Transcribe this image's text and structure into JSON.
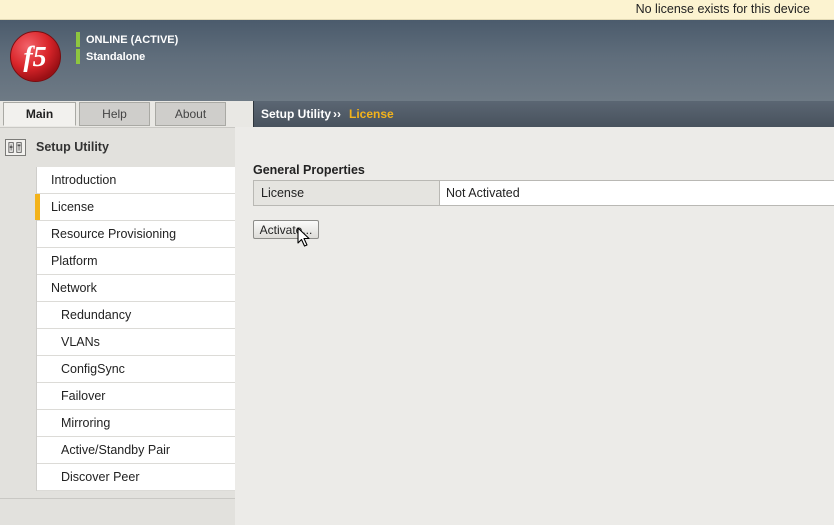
{
  "notice": {
    "text": "No license exists for this device"
  },
  "banner": {
    "logo_text": "f5",
    "status": [
      "ONLINE (ACTIVE)",
      "Standalone"
    ]
  },
  "tabs": [
    {
      "label": "Main",
      "active": true
    },
    {
      "label": "Help",
      "active": false
    },
    {
      "label": "About",
      "active": false
    }
  ],
  "breadcrumb": {
    "section": "Setup Utility",
    "separator": "››",
    "page": "License"
  },
  "sidebar": {
    "title": "Setup Utility",
    "items": [
      {
        "label": "Introduction",
        "level": 1
      },
      {
        "label": "License",
        "level": 1,
        "active": true
      },
      {
        "label": "Resource Provisioning",
        "level": 1
      },
      {
        "label": "Platform",
        "level": 1
      },
      {
        "label": "Network",
        "level": 1
      },
      {
        "label": "Redundancy",
        "level": 2
      },
      {
        "label": "VLANs",
        "level": 2
      },
      {
        "label": "ConfigSync",
        "level": 2
      },
      {
        "label": "Failover",
        "level": 2
      },
      {
        "label": "Mirroring",
        "level": 2
      },
      {
        "label": "Active/Standby Pair",
        "level": 2
      },
      {
        "label": "Discover Peer",
        "level": 2
      }
    ]
  },
  "main": {
    "section_title": "General Properties",
    "properties": [
      {
        "label": "License",
        "value": "Not Activated"
      }
    ],
    "activate_button": "Activate..."
  },
  "colors": {
    "accent": "#f3b31b",
    "status_green": "#8ec63f",
    "logo_red": "#d9252a"
  }
}
